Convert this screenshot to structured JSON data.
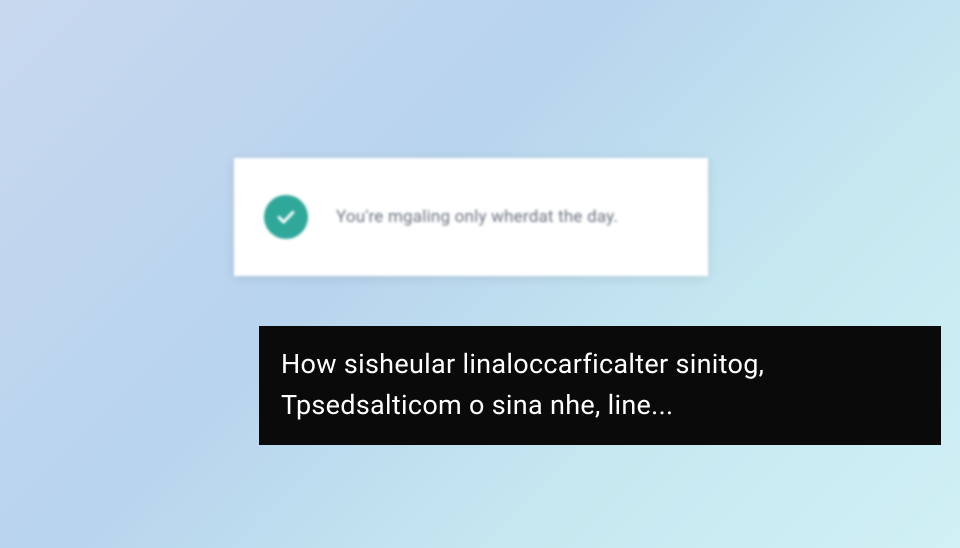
{
  "notification": {
    "message": "You're mgaling only wherdat the day.",
    "icon": "checkmark"
  },
  "caption": {
    "line1": "How sisheular linaloccarficalter sinitog,",
    "line2": "Tpsedsalticom o sina nhe, line..."
  },
  "colors": {
    "accent": "#2fa89a",
    "caption_bg": "#0a0a0a",
    "caption_text": "#ffffff",
    "notification_text": "#6b7280"
  }
}
